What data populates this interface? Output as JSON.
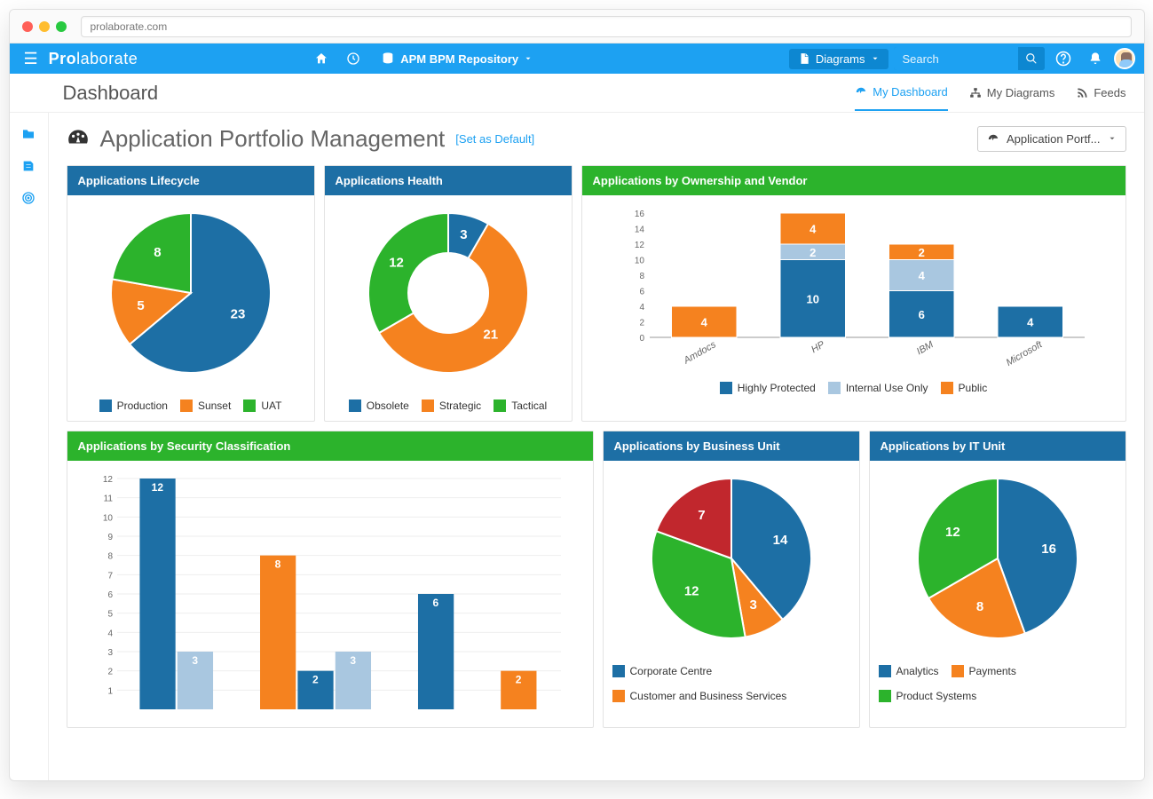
{
  "browser": {
    "url": "prolaborate.com"
  },
  "brand": {
    "bold": "Pro",
    "rest": "laborate"
  },
  "topbar": {
    "repository": "APM BPM Repository",
    "diagrams_btn": "Diagrams",
    "search_placeholder": "Search"
  },
  "subbar": {
    "title": "Dashboard",
    "tabs": [
      {
        "label": "My Dashboard",
        "icon": "dashboard-icon",
        "active": true
      },
      {
        "label": "My Diagrams",
        "icon": "sitemap-icon",
        "active": false
      },
      {
        "label": "Feeds",
        "icon": "rss-icon",
        "active": false
      }
    ]
  },
  "heading": {
    "title": "Application Portfolio Management",
    "set_default": "[Set as Default]",
    "profile_selected": "Application Portf..."
  },
  "colors": {
    "blue": "#1d6fa5",
    "orange": "#f5821f",
    "green": "#2cb32c",
    "lightblue": "#a9c7e0",
    "red": "#c1272d"
  },
  "panels": {
    "lifecycle": {
      "title": "Applications Lifecycle"
    },
    "health": {
      "title": "Applications Health"
    },
    "ownership": {
      "title": "Applications by Ownership and Vendor"
    },
    "security": {
      "title": "Applications by Security Classification"
    },
    "bizunit": {
      "title": "Applications by Business Unit"
    },
    "itunit": {
      "title": "Applications by IT Unit"
    }
  },
  "legends": {
    "lifecycle": [
      "Production",
      "Sunset",
      "UAT"
    ],
    "health": [
      "Obsolete",
      "Strategic",
      "Tactical"
    ],
    "ownership": [
      "Highly Protected",
      "Internal Use Only",
      "Public"
    ],
    "bizunit": [
      "Corporate Centre",
      "Customer and Business Services"
    ],
    "itunit": [
      "Analytics",
      "Payments",
      "Product Systems"
    ]
  },
  "chart_data": [
    {
      "id": "lifecycle",
      "type": "pie",
      "title": "Applications Lifecycle",
      "series": [
        {
          "name": "Production",
          "value": 23,
          "color": "#1d6fa5"
        },
        {
          "name": "Sunset",
          "value": 5,
          "color": "#f5821f"
        },
        {
          "name": "UAT",
          "value": 8,
          "color": "#2cb32c"
        }
      ]
    },
    {
      "id": "health",
      "type": "pie",
      "donut": true,
      "title": "Applications Health",
      "series": [
        {
          "name": "Obsolete",
          "value": 3,
          "color": "#1d6fa5"
        },
        {
          "name": "Strategic",
          "value": 21,
          "color": "#f5821f"
        },
        {
          "name": "Tactical",
          "value": 12,
          "color": "#2cb32c"
        }
      ]
    },
    {
      "id": "ownership",
      "type": "bar",
      "stacked": true,
      "title": "Applications by Ownership and Vendor",
      "categories": [
        "Amdocs",
        "HP",
        "IBM",
        "Microsoft"
      ],
      "ylim": [
        0,
        16
      ],
      "yticks": [
        0,
        2,
        4,
        6,
        8,
        10,
        12,
        14,
        16
      ],
      "series": [
        {
          "name": "Highly Protected",
          "color": "#1d6fa5",
          "values": [
            0,
            10,
            6,
            4
          ]
        },
        {
          "name": "Internal Use Only",
          "color": "#a9c7e0",
          "values": [
            0,
            2,
            4,
            0
          ]
        },
        {
          "name": "Public",
          "color": "#f5821f",
          "values": [
            4,
            4,
            2,
            0
          ]
        }
      ]
    },
    {
      "id": "security",
      "type": "bar",
      "grouped": true,
      "title": "Applications by Security Classification",
      "ylim": [
        0,
        12
      ],
      "yticks": [
        1,
        2,
        3,
        4,
        5,
        6,
        7,
        8,
        9,
        10,
        11,
        12
      ],
      "groups": [
        {
          "bars": [
            {
              "value": 12,
              "color": "#1d6fa5"
            },
            {
              "value": 3,
              "color": "#a9c7e0"
            }
          ]
        },
        {
          "bars": [
            {
              "value": 8,
              "color": "#f5821f"
            },
            {
              "value": 2,
              "color": "#1d6fa5"
            },
            {
              "value": 3,
              "color": "#a9c7e0"
            }
          ]
        },
        {
          "bars": [
            {
              "value": 6,
              "color": "#1d6fa5"
            }
          ]
        },
        {
          "bars": [
            {
              "value": 2,
              "color": "#f5821f"
            }
          ]
        }
      ]
    },
    {
      "id": "bizunit",
      "type": "pie",
      "title": "Applications by Business Unit",
      "series": [
        {
          "name": "Corporate Centre",
          "value": 14,
          "color": "#1d6fa5"
        },
        {
          "name": "Customer and Business Services",
          "value": 3,
          "color": "#f5821f"
        },
        {
          "name": "segment-green",
          "value": 12,
          "color": "#2cb32c"
        },
        {
          "name": "segment-red",
          "value": 7,
          "color": "#c1272d"
        }
      ]
    },
    {
      "id": "itunit",
      "type": "pie",
      "title": "Applications by IT Unit",
      "series": [
        {
          "name": "Analytics",
          "value": 16,
          "color": "#1d6fa5"
        },
        {
          "name": "Payments",
          "value": 8,
          "color": "#f5821f"
        },
        {
          "name": "Product Systems",
          "value": 12,
          "color": "#2cb32c"
        }
      ]
    }
  ]
}
